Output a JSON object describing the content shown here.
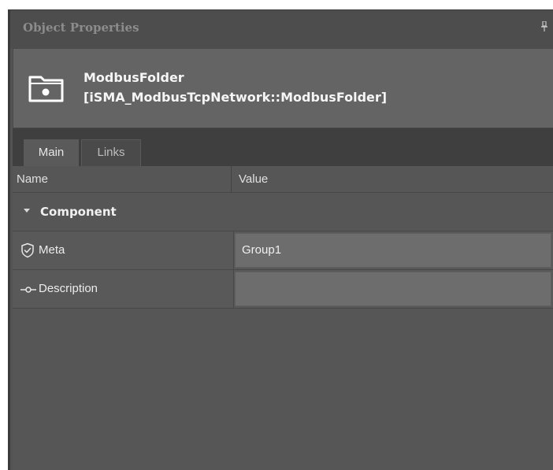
{
  "window": {
    "title": "Object Properties",
    "pin_icon": "pin-icon"
  },
  "object": {
    "icon": "folder-icon",
    "name": "ModbusFolder",
    "type": "[iSMA_ModbusTcpNetwork::ModbusFolder]"
  },
  "tabs": [
    {
      "label": "Main",
      "active": true
    },
    {
      "label": "Links",
      "active": false
    }
  ],
  "grid": {
    "columns": [
      "Name",
      "Value"
    ],
    "group": {
      "label": "Component",
      "expanded": true,
      "icon": "caret-down-icon"
    },
    "properties": [
      {
        "icon": "shield-check-icon",
        "name": "Meta",
        "value": "Group1"
      },
      {
        "icon": "link-slot-icon",
        "name": "Description",
        "value": ""
      }
    ]
  },
  "colors": {
    "panel": "#535353",
    "header": "#646464",
    "tab_strip": "#3f3f3f",
    "value_cell": "#6d6d6d",
    "text": "#f0f0f0"
  }
}
